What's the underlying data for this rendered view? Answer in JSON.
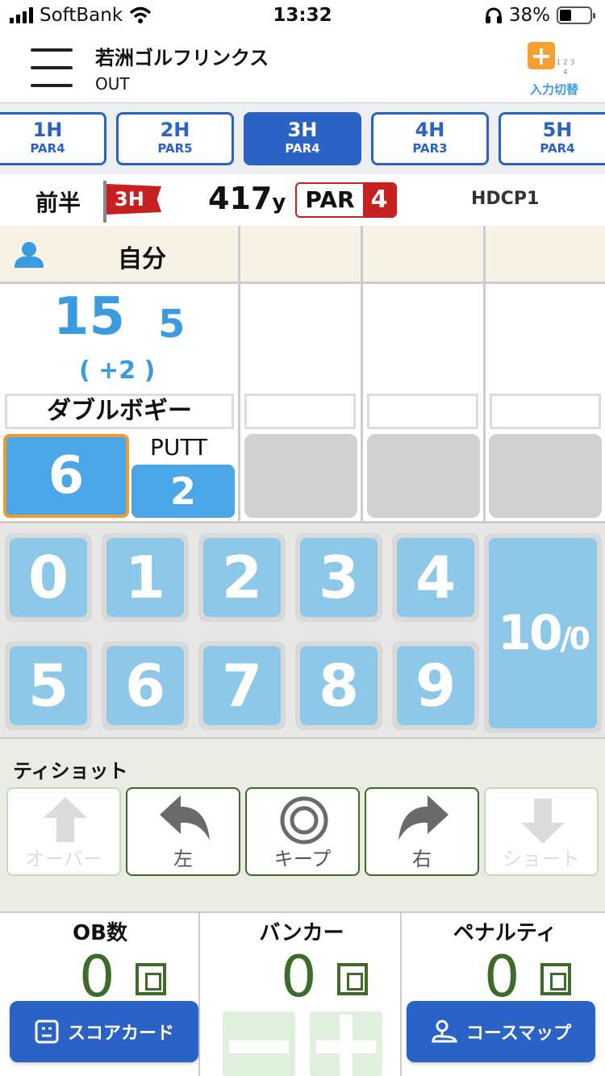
{
  "status_bar": {
    "carrier": "SoftBank",
    "time": "13:32",
    "battery": "38%"
  },
  "header": {
    "course_name": "若洲ゴルフリンクス",
    "half": "OUT",
    "switch_label": "入力切替",
    "switch_grid": "1 2 3 4"
  },
  "holes": [
    {
      "hole": "1H",
      "par": "PAR4"
    },
    {
      "hole": "2H",
      "par": "PAR5"
    },
    {
      "hole": "3H",
      "par": "PAR4"
    },
    {
      "hole": "4H",
      "par": "PAR3"
    },
    {
      "hole": "5H",
      "par": "PAR4"
    }
  ],
  "active_hole_index": 2,
  "hole_info": {
    "half_label": "前半",
    "flag_text": "3H",
    "yards": "417",
    "yard_unit": "y",
    "par_label": "PAR",
    "par_value": "4",
    "hdcp": "HDCP1"
  },
  "player": {
    "name": "自分",
    "total": "15",
    "over": "5",
    "diff": "( +2 )",
    "result_name": "ダブルボギー",
    "strokes": "6",
    "putt_label": "PUTT",
    "putts": "2"
  },
  "keypad": {
    "digits": [
      "0",
      "1",
      "2",
      "3",
      "4",
      "5",
      "6",
      "7",
      "8",
      "9"
    ],
    "ten_main": "10",
    "ten_sub": "/0"
  },
  "tee_shot": {
    "title": "ティショット",
    "buttons": [
      "オーバー",
      "左",
      "キープ",
      "右",
      "ショート"
    ]
  },
  "counters": [
    {
      "label": "OB数",
      "value": "0"
    },
    {
      "label": "バンカー",
      "value": "0"
    },
    {
      "label": "ペナルティ",
      "value": "0"
    }
  ],
  "footer": {
    "scorecard": "スコアカード",
    "coursemap": "コースマップ"
  },
  "colors": {
    "accent": "#2a62c6",
    "score_blue": "#4aa6e6",
    "key_blue": "#8ec8e8",
    "green": "#3d6b2a",
    "red": "#c62020",
    "orange": "#ef9a33"
  }
}
